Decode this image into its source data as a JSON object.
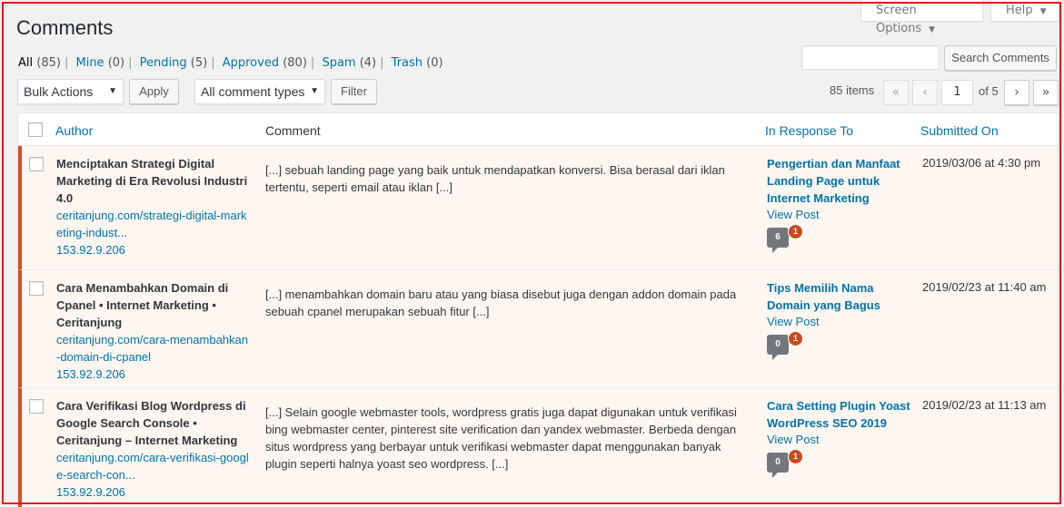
{
  "screen_options": {
    "label": "Screen Options"
  },
  "help": {
    "label": "Help"
  },
  "page_title": "Comments",
  "filters": [
    {
      "label": "All",
      "count": "(85)"
    },
    {
      "label": "Mine",
      "count": "(0)"
    },
    {
      "label": "Pending",
      "count": "(5)"
    },
    {
      "label": "Approved",
      "count": "(80)"
    },
    {
      "label": "Spam",
      "count": "(4)"
    },
    {
      "label": "Trash",
      "count": "(0)"
    }
  ],
  "search": {
    "placeholder": "",
    "button_label": "Search Comments"
  },
  "bulk_actions": {
    "selected": "Bulk Actions",
    "apply_label": "Apply"
  },
  "comment_types": {
    "selected": "All comment types",
    "filter_label": "Filter"
  },
  "pagination": {
    "items": "85 items",
    "first": "«",
    "prev": "‹",
    "current_page": "1",
    "of_label": "of 5",
    "next": "›",
    "last": "»"
  },
  "columns": {
    "author": "Author",
    "comment": "Comment",
    "response": "In Response To",
    "submitted": "Submitted On"
  },
  "rows": [
    {
      "author_name": "Menciptakan Strategi Digital Marketing di Era Revolusi Industri 4.0",
      "author_url": "ceritanjung.com/strategi-digital-marketing-indust...",
      "author_ip": "153.92.9.206",
      "comment": "[...] sebuah landing page yang baik untuk mendapatkan konversi. Bisa berasal dari iklan tertentu, seperti email atau iklan [...]",
      "response_title": "Pengertian dan Manfaat Landing Page untuk Internet Marketing",
      "view_post": "View Post",
      "approved_count": "6",
      "pending_count": "1",
      "date": "2019/03/06 at 4:30 pm"
    },
    {
      "author_name": "Cara Menambahkan Domain di Cpanel • Internet Marketing • Ceritanjung",
      "author_url": "ceritanjung.com/cara-menambahkan-domain-di-cpanel",
      "author_ip": "153.92.9.206",
      "comment": "[...] menambahkan domain baru atau yang biasa disebut juga dengan addon domain pada sebuah cpanel merupakan sebuah fitur [...]",
      "response_title": "Tips Memilih Nama Domain yang Bagus",
      "view_post": "View Post",
      "approved_count": "0",
      "pending_count": "1",
      "date": "2019/02/23 at 11:40 am"
    },
    {
      "author_name": "Cara Verifikasi Blog Wordpress di Google Search Console • Ceritanjung – Internet Marketing",
      "author_url": "ceritanjung.com/cara-verifikasi-google-search-con...",
      "author_ip": "153.92.9.206",
      "comment": "[...] Selain google webmaster tools, wordpress gratis juga dapat digunakan untuk verifikasi bing webmaster center, pinterest site verification dan yandex webmaster. Berbeda dengan situs wordpress yang berbayar untuk verifikasi webmaster dapat menggunakan banyak plugin seperti halnya yoast seo wordpress. [...]",
      "response_title": "Cara Setting Plugin Yoast WordPress SEO 2019",
      "view_post": "View Post",
      "approved_count": "0",
      "pending_count": "1",
      "date": "2019/02/23 at 11:13 am"
    }
  ]
}
